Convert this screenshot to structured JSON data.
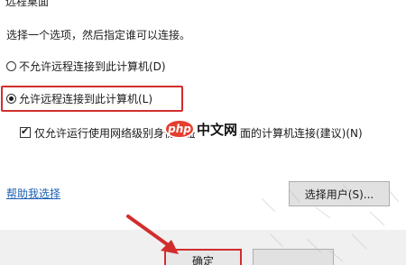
{
  "group_title": "远程桌面",
  "instruction": "选择一个选项，然后指定谁可以连接。",
  "options": {
    "deny": {
      "label": "不允许远程连接到此计算机(D)",
      "selected": false
    },
    "allow": {
      "label": "允许远程连接到此计算机(L)",
      "selected": true
    }
  },
  "nla_checkbox": {
    "label": "仅允许运行使用网络级别身份验证的远程桌面的计算机连接(建议)(N)",
    "checked": true
  },
  "watermark": {
    "logo": "php",
    "text": "中文网"
  },
  "help_link": "帮助我选择",
  "buttons": {
    "select_users": "选择用户(S)...",
    "ok": "确定",
    "cancel": ""
  },
  "colors": {
    "highlight": "#d22d2d",
    "link": "#1c5fb3",
    "watermark_logo": "#e43f2f"
  },
  "icons": {
    "annotation_arrow": "red-arrow-icon"
  }
}
